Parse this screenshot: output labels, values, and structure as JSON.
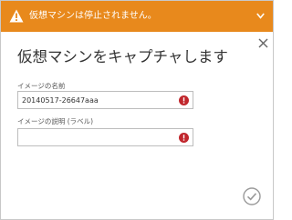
{
  "warning": {
    "message": "仮想マシンは停止されません。",
    "icon": "warning-triangle-icon",
    "bar_color": "#e8891c"
  },
  "dialog": {
    "title": "仮想マシンをキャプチャします",
    "close_icon": "close-icon",
    "confirm_icon": "checkmark-circle-icon"
  },
  "form": {
    "name_label": "イメージの名前",
    "name_value": "20140517-26647aaa",
    "description_label": "イメージの説明 (ラベル)",
    "description_value": "",
    "error_color": "#c1272d"
  }
}
